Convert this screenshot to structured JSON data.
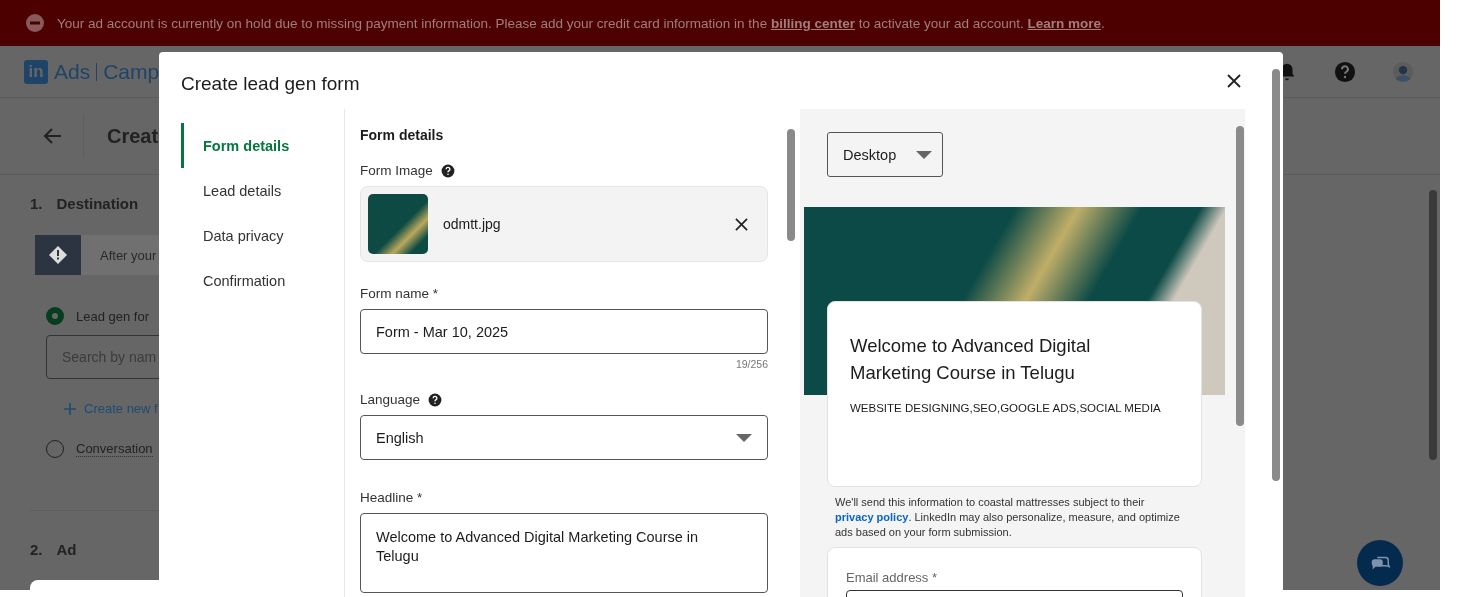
{
  "banner": {
    "text_before": "Your ad account is currently on hold due to missing payment information. Please add your credit card information in the ",
    "link": "billing center",
    "text_middle": " to activate your ad account. ",
    "link_2": "Learn more",
    "text_after": "."
  },
  "header": {
    "logo_mark": "in",
    "product": "Ads",
    "section": "Camp"
  },
  "page": {
    "title": "Creat",
    "alert": "After your",
    "search": {
      "placeholder": "Search by nam"
    },
    "create_link": "Create new f",
    "steps": [
      {
        "number": "1.",
        "label": "Destination"
      },
      {
        "number": "2.",
        "label": "Ad"
      }
    ],
    "options": [
      {
        "label": "Lead gen for",
        "selected": true
      },
      {
        "label": "Conversation",
        "selected": false
      }
    ]
  },
  "modal": {
    "title": "Create lead gen form",
    "nav": [
      {
        "label": "Form details",
        "selected": true
      },
      {
        "label": "Lead details",
        "selected": false
      },
      {
        "label": "Data privacy",
        "selected": false
      },
      {
        "label": "Confirmation",
        "selected": false
      }
    ],
    "section_title": "Form details",
    "form_image": {
      "label": "Form Image",
      "file_name": "odmtt.jpg"
    },
    "form_name": {
      "label": "Form name *",
      "value": "Form - Mar 10, 2025",
      "counter": "19/256"
    },
    "language": {
      "label": "Language",
      "value": "English"
    },
    "headline": {
      "label": "Headline *",
      "value": "Welcome to Advanced Digital Marketing Course in Telugu"
    },
    "preview": {
      "device": "Desktop",
      "headline": "Welcome to Advanced Digital Marketing Course in Telugu",
      "details": "WEBSITE DESIGNING,SEO,GOOGLE ADS,SOCIAL MEDIA",
      "privacy": {
        "text_before": "We'll send this information to coastal mattresses subject to their ",
        "link": "privacy policy",
        "text_after": ". LinkedIn may also personalize, measure, and optimize ads based on your form submission."
      },
      "email_label": "Email address *"
    }
  }
}
